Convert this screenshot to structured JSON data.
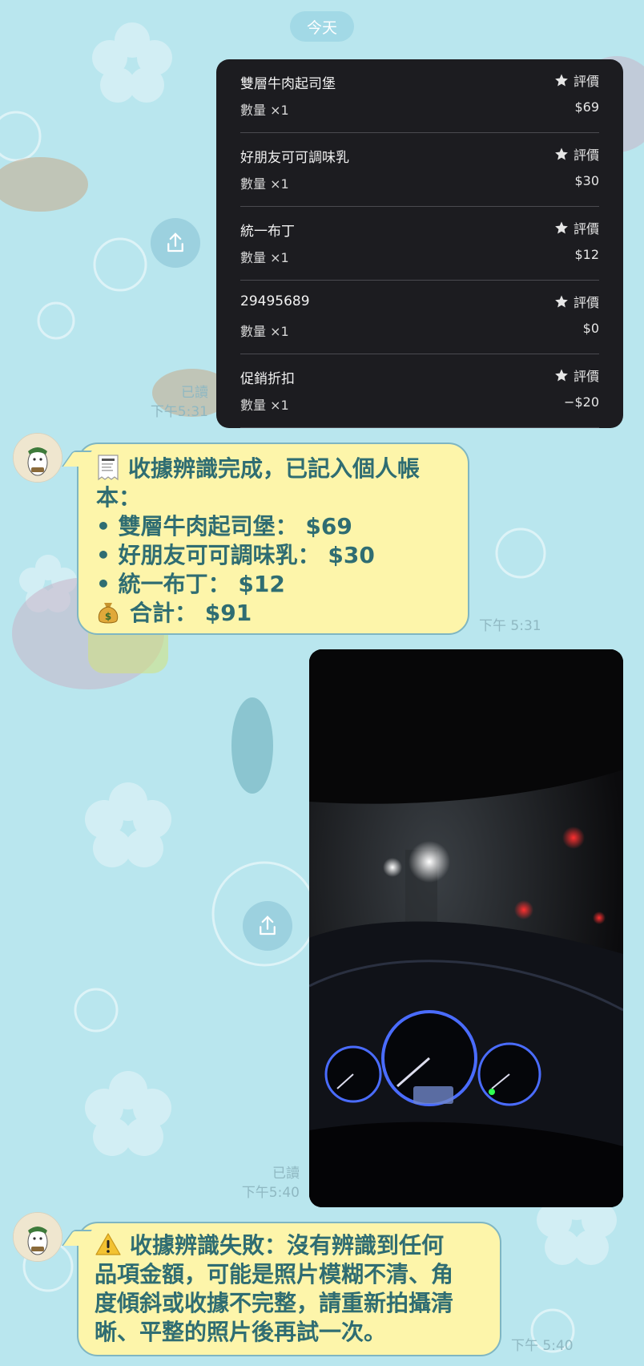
{
  "chat": {
    "date_label": "今天",
    "receipt_items": [
      {
        "name": "雙層牛肉起司堡",
        "rate_label": "評價",
        "qty": "數量 ×1",
        "price": "$69"
      },
      {
        "name": "好朋友可可調味乳",
        "rate_label": "評價",
        "qty": "數量 ×1",
        "price": "$30"
      },
      {
        "name": "統一布丁",
        "rate_label": "評價",
        "qty": "數量 ×1",
        "price": "$12"
      },
      {
        "name": "29495689",
        "rate_label": "評價",
        "qty": "數量 ×1",
        "price": "$0"
      },
      {
        "name": "促銷折扣",
        "rate_label": "評價",
        "qty": "數量 ×1",
        "price": "−$20"
      }
    ],
    "msg1_read": "已讀",
    "msg1_time": "下午5:31",
    "bot_msg1": {
      "lines": [
        "收據辨識完成，已記入個人帳",
        "本：",
        "• 雙層牛肉起司堡： $69",
        "• 好朋友可可調味乳： $30",
        "• 統一布丁： $12",
        "合計： $91"
      ],
      "time": "下午 5:31"
    },
    "msg2_read": "已讀",
    "msg2_time": "下午5:40",
    "bot_msg2": {
      "lines": [
        "收據辨識失敗：沒有辨識到任何",
        "品項金額，可能是照片模糊不清、角",
        "度傾斜或收據不完整，請重新拍攝清",
        "晰、平整的照片後再試一次。"
      ],
      "time": "下午 5:40"
    }
  },
  "colors": {
    "background": "#b9e6ee",
    "bot_bubble": "#fdf5aa",
    "bot_text": "#2f6d72",
    "receipt_card": "#1c1c20"
  },
  "icons": [
    "star-icon",
    "share-icon",
    "receipt-emoji-icon",
    "money-bag-icon",
    "warning-icon"
  ]
}
